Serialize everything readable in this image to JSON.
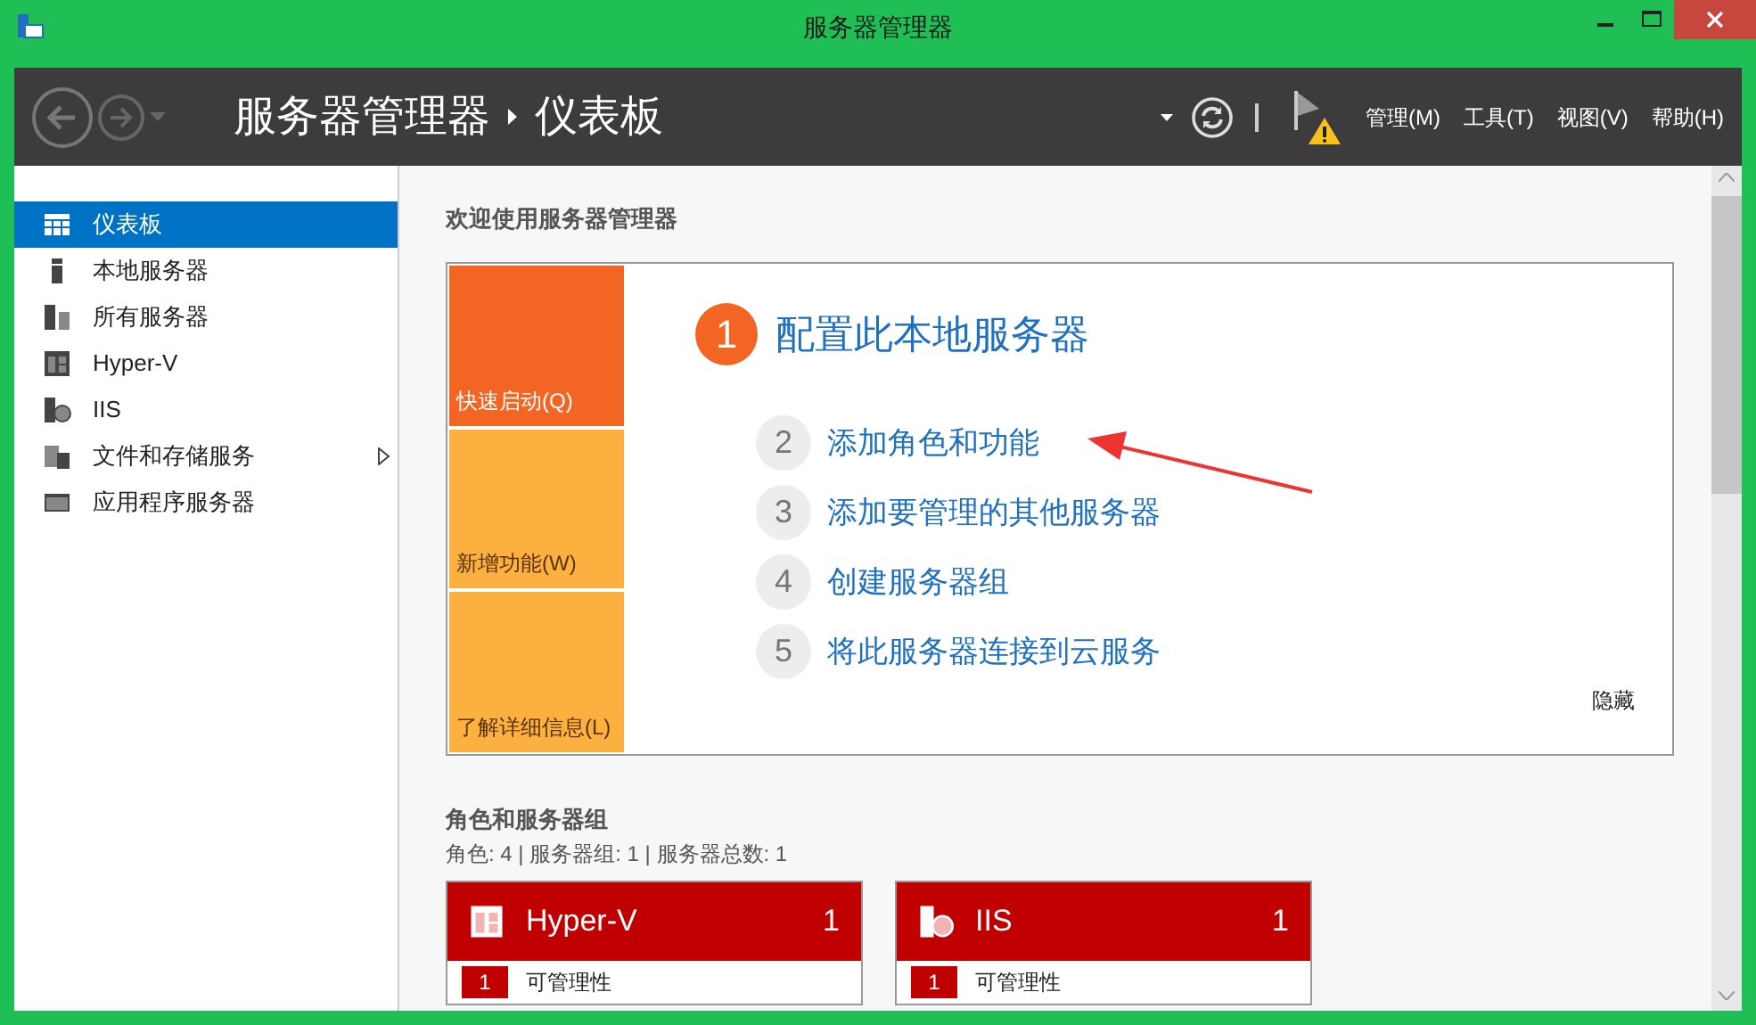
{
  "window": {
    "title": "服务器管理器"
  },
  "header": {
    "root": "服务器管理器",
    "current": "仪表板",
    "menus": [
      "管理(M)",
      "工具(T)",
      "视图(V)",
      "帮助(H)"
    ]
  },
  "sidebar": {
    "items": [
      {
        "label": "仪表板",
        "kind": "dashboard",
        "selected": true,
        "expandable": false
      },
      {
        "label": "本地服务器",
        "kind": "local",
        "selected": false,
        "expandable": false
      },
      {
        "label": "所有服务器",
        "kind": "all",
        "selected": false,
        "expandable": false
      },
      {
        "label": "Hyper-V",
        "kind": "hyperv",
        "selected": false,
        "expandable": false
      },
      {
        "label": "IIS",
        "kind": "iis",
        "selected": false,
        "expandable": false
      },
      {
        "label": "文件和存储服务",
        "kind": "files",
        "selected": false,
        "expandable": true
      },
      {
        "label": "应用程序服务器",
        "kind": "apps",
        "selected": false,
        "expandable": false
      }
    ]
  },
  "welcome": {
    "heading": "欢迎使用服务器管理器",
    "tiles": [
      {
        "label": "快速启动(Q)",
        "color": "#f26522"
      },
      {
        "label": "新增功能(W)",
        "color": "#fbb040"
      },
      {
        "label": "了解详细信息(L)",
        "color": "#fbb040"
      }
    ],
    "main_step": {
      "number": "1",
      "label": "配置此本地服务器"
    },
    "steps": [
      {
        "number": "2",
        "label": "添加角色和功能"
      },
      {
        "number": "3",
        "label": "添加要管理的其他服务器"
      },
      {
        "number": "4",
        "label": "创建服务器组"
      },
      {
        "number": "5",
        "label": "将此服务器连接到云服务"
      }
    ],
    "hide": "隐藏"
  },
  "roles": {
    "heading": "角色和服务器组",
    "summary": "角色: 4 | 服务器组: 1 | 服务器总数: 1",
    "cards": [
      {
        "name": "Hyper-V",
        "kind": "hyperv",
        "count": "1",
        "rows": [
          {
            "count": "1",
            "label": "可管理性"
          }
        ]
      },
      {
        "name": "IIS",
        "kind": "iis",
        "count": "1",
        "rows": [
          {
            "count": "1",
            "label": "可管理性"
          }
        ]
      }
    ]
  }
}
